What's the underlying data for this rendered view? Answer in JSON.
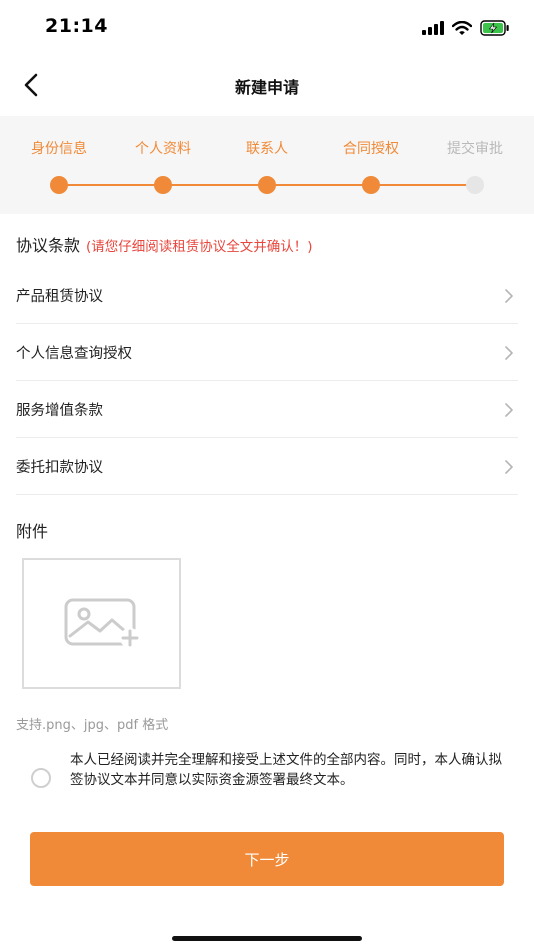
{
  "status_bar": {
    "time": "21:14",
    "icons": [
      "signal-icon",
      "wifi-icon",
      "battery-charging-icon"
    ],
    "battery_color": "#3cc34a"
  },
  "nav": {
    "title": "新建申请",
    "back_icon": "chevron-left-icon"
  },
  "steps": [
    {
      "label": "身份信息",
      "state": "done"
    },
    {
      "label": "个人资料",
      "state": "done"
    },
    {
      "label": "联系人",
      "state": "done"
    },
    {
      "label": "合同授权",
      "state": "current"
    },
    {
      "label": "提交审批",
      "state": "pending"
    }
  ],
  "agreements": {
    "title": "协议条款",
    "hint": "(请您仔细阅读租赁协议全文并确认！)",
    "items": [
      {
        "label": "产品租赁协议"
      },
      {
        "label": "个人信息查询授权"
      },
      {
        "label": "服务增值条款"
      },
      {
        "label": "委托扣款协议"
      }
    ]
  },
  "attachment": {
    "title": "附件",
    "upload_icon": "image-add-icon",
    "formats": "支持.png、jpg、pdf 格式"
  },
  "consent": {
    "checked": false,
    "text": "本人已经阅读并完全理解和接受上述文件的全部内容。同时，本人确认拟签协议文本并同意以实际资金源签署最终文本。"
  },
  "next_button": {
    "label": "下一步"
  },
  "colors": {
    "accent": "#f08a38",
    "hint_red": "#e8453c",
    "pending_gray": "#b9b9b9"
  }
}
